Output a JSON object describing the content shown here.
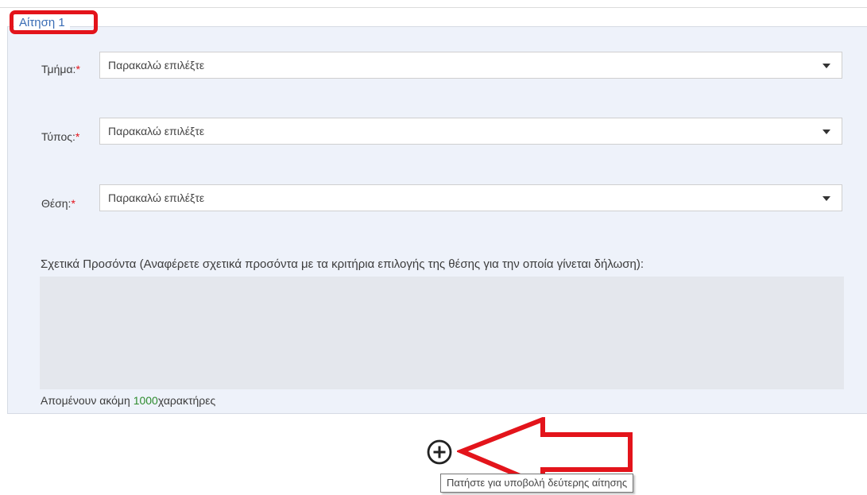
{
  "fieldset": {
    "legend": "Αίτηση 1"
  },
  "fields": [
    {
      "label": "Τμήμα:",
      "required": "*",
      "value": "Παρακαλώ επιλέξτε"
    },
    {
      "label": "Τύπος:",
      "required": "*",
      "value": "Παρακαλώ επιλέξτε"
    },
    {
      "label": "Θέση:",
      "required": "*",
      "value": "Παρακαλώ επιλέξτε"
    }
  ],
  "qualifications": {
    "label": "Σχετικά Προσόντα (Αναφέρετε σχετικά προσόντα με τα κριτήρια επιλογής της θέσης για την οποία γίνεται δήλωση):",
    "value": "",
    "remaining_prefix": "Απομένουν ακόμη",
    "remaining_count": "1000",
    "remaining_suffix": "χαρακτήρες"
  },
  "add_request": {
    "icon": "plus-circle-icon",
    "tooltip": "Πατήστε για υποβολή δεύτερης αίτησης"
  },
  "colors": {
    "legend_text": "#3a6db5",
    "required": "#e3141b",
    "highlight": "#e3141b",
    "counter": "#2e8b2e",
    "panel_bg": "#eef2fa"
  }
}
